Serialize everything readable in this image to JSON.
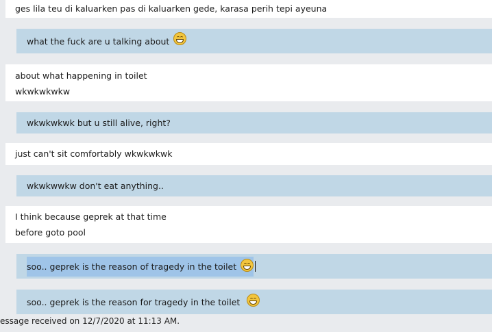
{
  "messages": [
    {
      "text": "ges lila teu di kaluarken pas di kaluarken gede, karasa perih tepi ayeuna"
    },
    {
      "text": "what the fuck are u talking about",
      "emoji": "grin-emoji"
    },
    {
      "lines": [
        "about what happening in toilet",
        "wkwkwkwkw"
      ]
    },
    {
      "text": "wkwkwkwk but u still alive, right?"
    },
    {
      "text": "just can't sit comfortably wkwkwkwk"
    },
    {
      "text": "wkwkwwkw don't eat anything.."
    },
    {
      "lines": [
        "I think because geprek at that time",
        "before goto pool"
      ]
    },
    {
      "text": "soo.. geprek is the reason of tragedy in the toilet",
      "emoji": "grin-emoji",
      "editing": true
    },
    {
      "text": "soo.. geprek is the reason for tragedy in the toilet",
      "emoji": "grin-emoji"
    }
  ],
  "status": "essage received on 12/7/2020 at 11:13 AM.",
  "colors": {
    "incoming": "#ffffff",
    "outgoing": "#c0d7e6",
    "selection": "#9fc4e8",
    "background": "#e9ebee"
  }
}
